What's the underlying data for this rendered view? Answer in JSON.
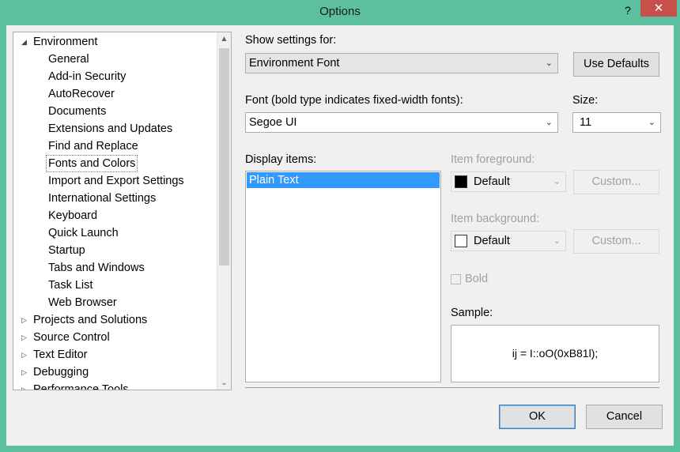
{
  "window": {
    "title": "Options",
    "help_glyph": "?",
    "close_glyph": "✕"
  },
  "tree": {
    "items": [
      {
        "label": "Environment",
        "level": 0,
        "expanded": true
      },
      {
        "label": "General",
        "level": 1
      },
      {
        "label": "Add-in Security",
        "level": 1
      },
      {
        "label": "AutoRecover",
        "level": 1
      },
      {
        "label": "Documents",
        "level": 1
      },
      {
        "label": "Extensions and Updates",
        "level": 1
      },
      {
        "label": "Find and Replace",
        "level": 1
      },
      {
        "label": "Fonts and Colors",
        "level": 1,
        "selected": true
      },
      {
        "label": "Import and Export Settings",
        "level": 1
      },
      {
        "label": "International Settings",
        "level": 1
      },
      {
        "label": "Keyboard",
        "level": 1
      },
      {
        "label": "Quick Launch",
        "level": 1
      },
      {
        "label": "Startup",
        "level": 1
      },
      {
        "label": "Tabs and Windows",
        "level": 1
      },
      {
        "label": "Task List",
        "level": 1
      },
      {
        "label": "Web Browser",
        "level": 1
      },
      {
        "label": "Projects and Solutions",
        "level": 0,
        "expanded": false
      },
      {
        "label": "Source Control",
        "level": 0,
        "expanded": false
      },
      {
        "label": "Text Editor",
        "level": 0,
        "expanded": false
      },
      {
        "label": "Debugging",
        "level": 0,
        "expanded": false
      },
      {
        "label": "Performance Tools",
        "level": 0,
        "expanded": false
      }
    ],
    "expanded_glyph": "◢",
    "collapsed_glyph": "▷",
    "scroll_up_glyph": "▲",
    "scroll_down_glyph": "⌄"
  },
  "settings": {
    "show_settings_label": "Show settings for:",
    "show_settings_value": "Environment Font",
    "use_defaults_label": "Use Defaults",
    "font_label": "Font (bold type indicates fixed-width fonts):",
    "font_value": "Segoe UI",
    "size_label": "Size:",
    "size_value": "11",
    "display_items_label": "Display items:",
    "display_items": [
      "Plain Text"
    ],
    "item_foreground_label": "Item foreground:",
    "item_foreground_value": "Default",
    "item_foreground_color": "#000000",
    "item_background_label": "Item background:",
    "item_background_value": "Default",
    "item_background_color": "#ffffff",
    "custom_label": "Custom...",
    "bold_label": "Bold",
    "sample_label": "Sample:",
    "sample_text": "ij = I::oO(0xB81l);",
    "dropdown_glyph": "⌄"
  },
  "footer": {
    "ok_label": "OK",
    "cancel_label": "Cancel"
  },
  "colors": {
    "frame": "#5bbfa0",
    "close": "#c7504a",
    "selection": "#3399ff"
  }
}
